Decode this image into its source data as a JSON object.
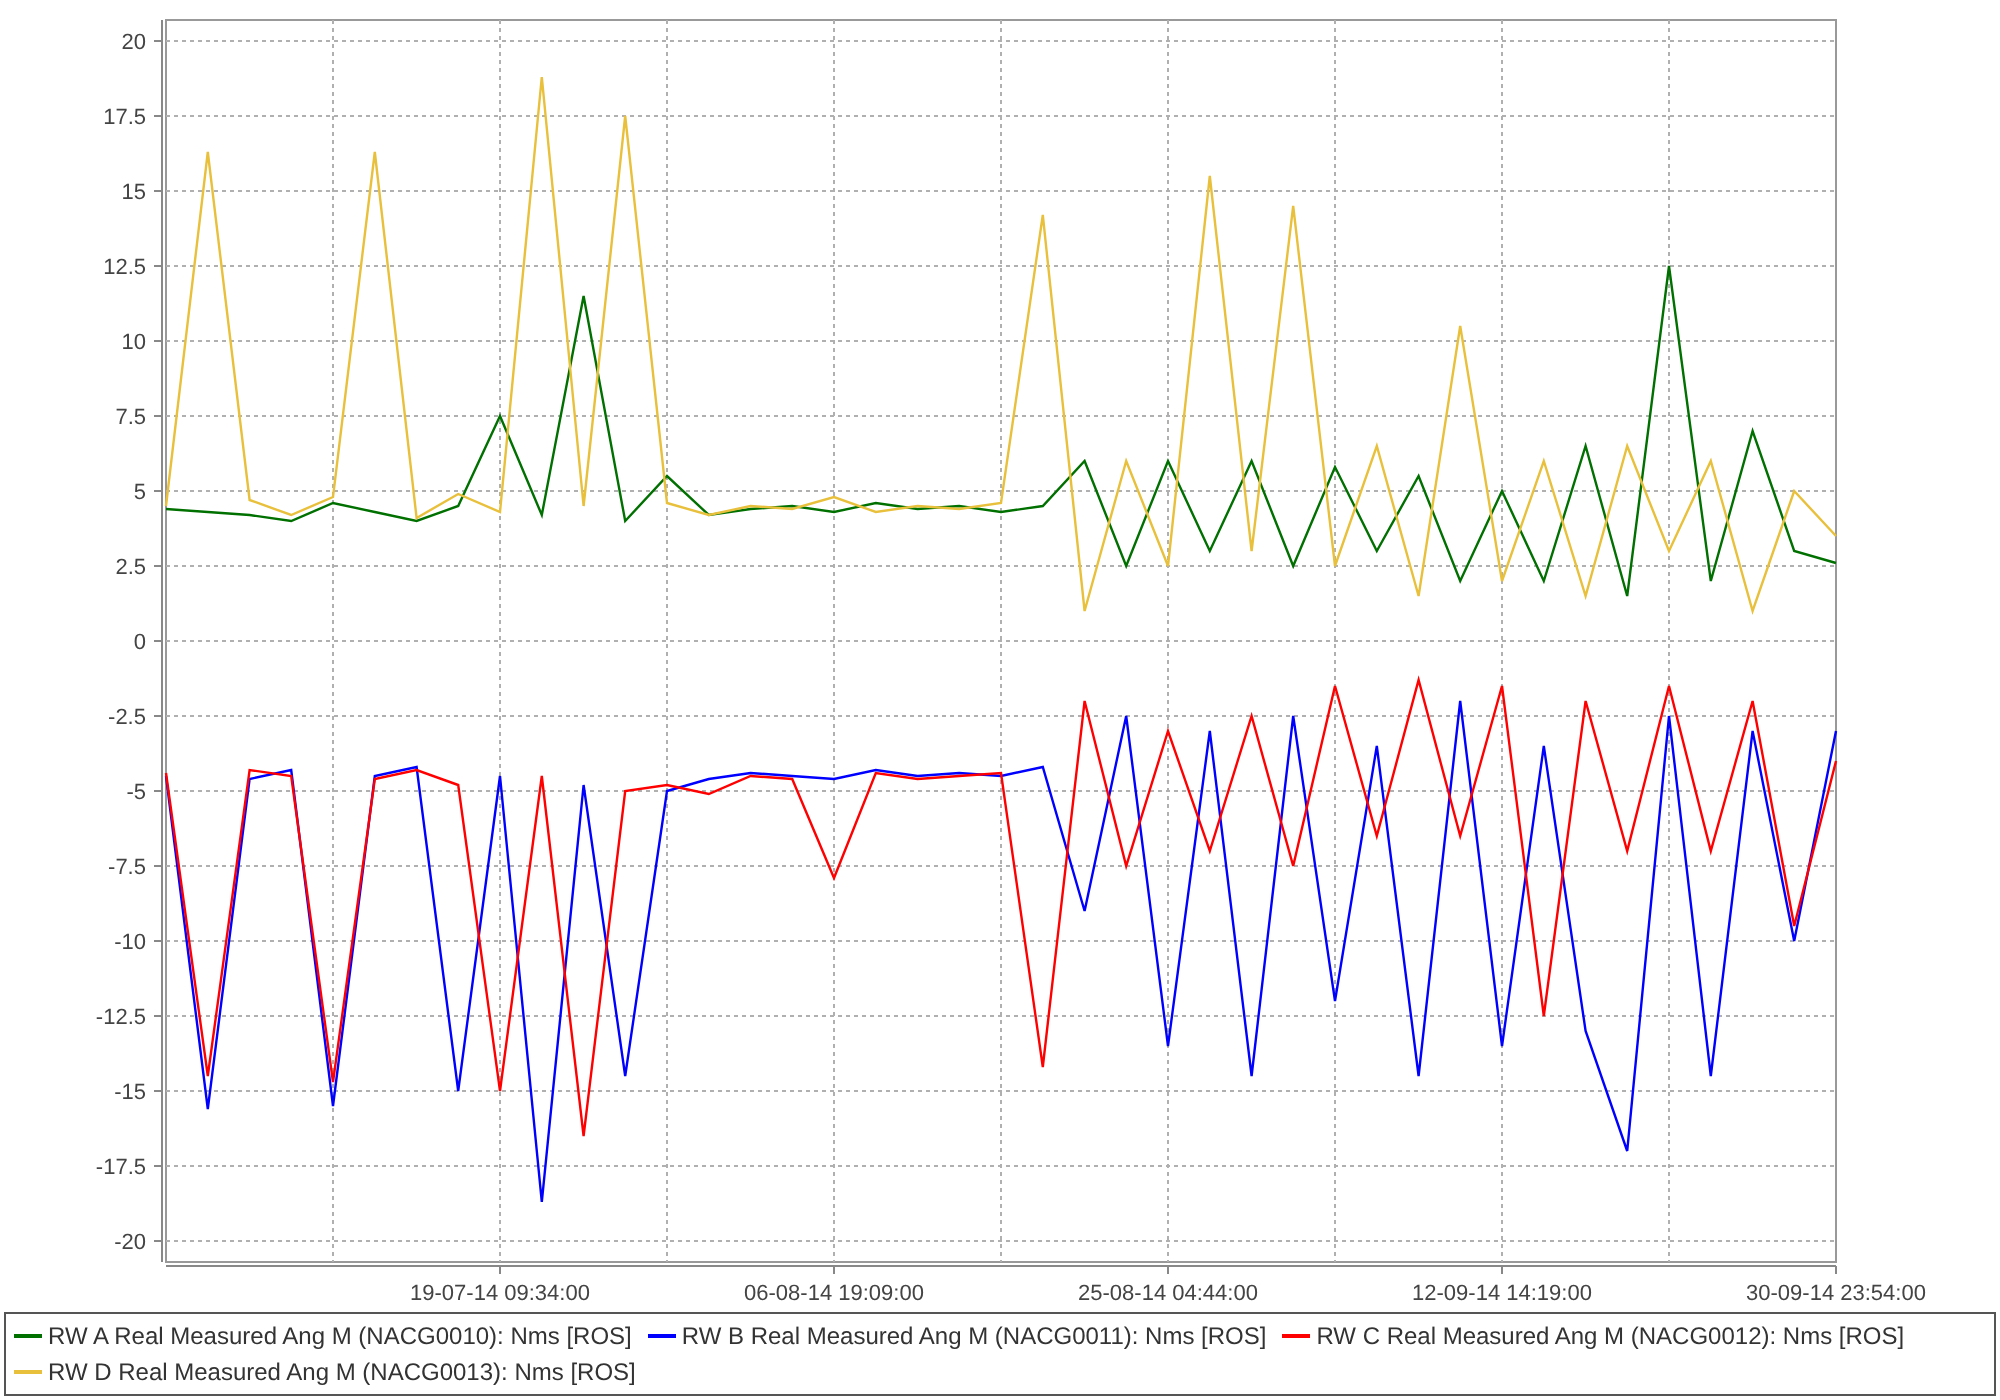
{
  "chart_data": {
    "type": "line",
    "categories": [
      null,
      null,
      null,
      null,
      null,
      null,
      null,
      null,
      "19-07-14 09:34:00",
      null,
      null,
      null,
      null,
      null,
      null,
      null,
      "06-08-14 19:09:00",
      null,
      null,
      null,
      null,
      null,
      null,
      null,
      "25-08-14 04:44:00",
      null,
      null,
      null,
      null,
      null,
      null,
      null,
      "12-09-14 14:19:00",
      null,
      null,
      null,
      null,
      null,
      null,
      null,
      "30-09-14 23:54:00"
    ],
    "ylim": [
      -20.7,
      20.7
    ],
    "grid": true,
    "yticks": [
      20,
      17.5,
      15,
      12.5,
      10,
      7.5,
      5,
      2.5,
      0,
      -2.5,
      -5,
      -7.5,
      -10,
      -12.5,
      -15,
      -17.5,
      -20
    ],
    "series": [
      {
        "name": "RW A Real Measured Ang M (NACG0010): Nms [ROS]",
        "color": "#007000",
        "values": [
          4.4,
          4.3,
          4.2,
          4.0,
          4.6,
          4.3,
          4.0,
          4.5,
          7.5,
          4.2,
          11.5,
          4.0,
          5.5,
          4.2,
          4.4,
          4.5,
          4.3,
          4.6,
          4.4,
          4.5,
          4.3,
          4.5,
          6.0,
          2.5,
          6.0,
          3.0,
          6.0,
          2.5,
          5.8,
          3.0,
          5.5,
          2.0,
          5.0,
          2.0,
          6.5,
          1.5,
          12.5,
          2.0,
          7.0,
          3.0,
          2.6
        ]
      },
      {
        "name": "RW B Real Measured Ang M (NACG0011): Nms [ROS]",
        "color": "#0000ff",
        "values": [
          -4.5,
          -15.6,
          -4.6,
          -4.3,
          -15.5,
          -4.5,
          -4.2,
          -15.0,
          -4.5,
          -18.7,
          -4.8,
          -14.5,
          -5.0,
          -4.6,
          -4.4,
          -4.5,
          -4.6,
          -4.3,
          -4.5,
          -4.4,
          -4.5,
          -4.2,
          -9.0,
          -2.5,
          -13.5,
          -3.0,
          -14.5,
          -2.5,
          -12.0,
          -3.5,
          -14.5,
          -2.0,
          -13.5,
          -3.5,
          -13.0,
          -17.0,
          -2.5,
          -14.5,
          -3.0,
          -10.0,
          -3.0
        ]
      },
      {
        "name": "RW C Real Measured Ang M (NACG0012): Nms [ROS]",
        "color": "#ff0000",
        "values": [
          -4.4,
          -14.5,
          -4.3,
          -4.5,
          -14.7,
          -4.6,
          -4.3,
          -4.8,
          -15.0,
          -4.5,
          -16.5,
          -5.0,
          -4.8,
          -5.1,
          -4.5,
          -4.6,
          -7.9,
          -4.4,
          -4.6,
          -4.5,
          -4.4,
          -14.2,
          -2.0,
          -7.5,
          -3.0,
          -7.0,
          -2.5,
          -7.5,
          -1.5,
          -6.5,
          -1.3,
          -6.5,
          -1.5,
          -12.5,
          -2.0,
          -7.0,
          -1.5,
          -7.0,
          -2.0,
          -9.5,
          -4.0
        ]
      },
      {
        "name": "RW D Real Measured Ang M (NACG0013): Nms [ROS]",
        "color": "#e8c03c",
        "values": [
          4.5,
          16.3,
          4.7,
          4.2,
          4.8,
          16.3,
          4.1,
          4.9,
          4.3,
          18.8,
          4.5,
          17.5,
          4.6,
          4.2,
          4.5,
          4.4,
          4.8,
          4.3,
          4.5,
          4.4,
          4.6,
          14.2,
          1.0,
          6.0,
          2.5,
          15.5,
          3.0,
          14.5,
          2.5,
          6.5,
          1.5,
          10.5,
          2.0,
          6.0,
          1.5,
          6.5,
          3.0,
          6.0,
          1.0,
          5.0,
          3.5
        ]
      }
    ]
  }
}
